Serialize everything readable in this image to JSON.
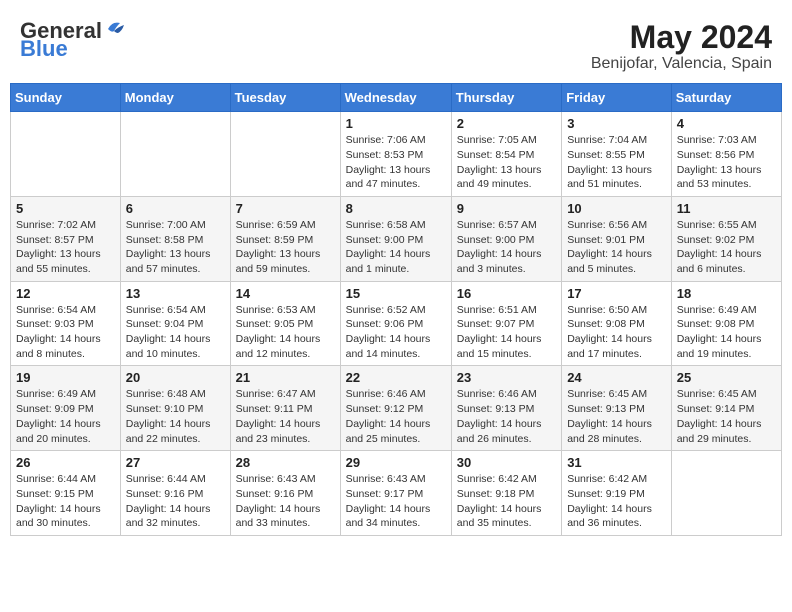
{
  "logo": {
    "general": "General",
    "blue": "Blue"
  },
  "header": {
    "month": "May 2024",
    "location": "Benijofar, Valencia, Spain"
  },
  "weekdays": [
    "Sunday",
    "Monday",
    "Tuesday",
    "Wednesday",
    "Thursday",
    "Friday",
    "Saturday"
  ],
  "weeks": [
    [
      {
        "day": "",
        "info": ""
      },
      {
        "day": "",
        "info": ""
      },
      {
        "day": "",
        "info": ""
      },
      {
        "day": "1",
        "info": "Sunrise: 7:06 AM\nSunset: 8:53 PM\nDaylight: 13 hours and 47 minutes."
      },
      {
        "day": "2",
        "info": "Sunrise: 7:05 AM\nSunset: 8:54 PM\nDaylight: 13 hours and 49 minutes."
      },
      {
        "day": "3",
        "info": "Sunrise: 7:04 AM\nSunset: 8:55 PM\nDaylight: 13 hours and 51 minutes."
      },
      {
        "day": "4",
        "info": "Sunrise: 7:03 AM\nSunset: 8:56 PM\nDaylight: 13 hours and 53 minutes."
      }
    ],
    [
      {
        "day": "5",
        "info": "Sunrise: 7:02 AM\nSunset: 8:57 PM\nDaylight: 13 hours and 55 minutes."
      },
      {
        "day": "6",
        "info": "Sunrise: 7:00 AM\nSunset: 8:58 PM\nDaylight: 13 hours and 57 minutes."
      },
      {
        "day": "7",
        "info": "Sunrise: 6:59 AM\nSunset: 8:59 PM\nDaylight: 13 hours and 59 minutes."
      },
      {
        "day": "8",
        "info": "Sunrise: 6:58 AM\nSunset: 9:00 PM\nDaylight: 14 hours and 1 minute."
      },
      {
        "day": "9",
        "info": "Sunrise: 6:57 AM\nSunset: 9:00 PM\nDaylight: 14 hours and 3 minutes."
      },
      {
        "day": "10",
        "info": "Sunrise: 6:56 AM\nSunset: 9:01 PM\nDaylight: 14 hours and 5 minutes."
      },
      {
        "day": "11",
        "info": "Sunrise: 6:55 AM\nSunset: 9:02 PM\nDaylight: 14 hours and 6 minutes."
      }
    ],
    [
      {
        "day": "12",
        "info": "Sunrise: 6:54 AM\nSunset: 9:03 PM\nDaylight: 14 hours and 8 minutes."
      },
      {
        "day": "13",
        "info": "Sunrise: 6:54 AM\nSunset: 9:04 PM\nDaylight: 14 hours and 10 minutes."
      },
      {
        "day": "14",
        "info": "Sunrise: 6:53 AM\nSunset: 9:05 PM\nDaylight: 14 hours and 12 minutes."
      },
      {
        "day": "15",
        "info": "Sunrise: 6:52 AM\nSunset: 9:06 PM\nDaylight: 14 hours and 14 minutes."
      },
      {
        "day": "16",
        "info": "Sunrise: 6:51 AM\nSunset: 9:07 PM\nDaylight: 14 hours and 15 minutes."
      },
      {
        "day": "17",
        "info": "Sunrise: 6:50 AM\nSunset: 9:08 PM\nDaylight: 14 hours and 17 minutes."
      },
      {
        "day": "18",
        "info": "Sunrise: 6:49 AM\nSunset: 9:08 PM\nDaylight: 14 hours and 19 minutes."
      }
    ],
    [
      {
        "day": "19",
        "info": "Sunrise: 6:49 AM\nSunset: 9:09 PM\nDaylight: 14 hours and 20 minutes."
      },
      {
        "day": "20",
        "info": "Sunrise: 6:48 AM\nSunset: 9:10 PM\nDaylight: 14 hours and 22 minutes."
      },
      {
        "day": "21",
        "info": "Sunrise: 6:47 AM\nSunset: 9:11 PM\nDaylight: 14 hours and 23 minutes."
      },
      {
        "day": "22",
        "info": "Sunrise: 6:46 AM\nSunset: 9:12 PM\nDaylight: 14 hours and 25 minutes."
      },
      {
        "day": "23",
        "info": "Sunrise: 6:46 AM\nSunset: 9:13 PM\nDaylight: 14 hours and 26 minutes."
      },
      {
        "day": "24",
        "info": "Sunrise: 6:45 AM\nSunset: 9:13 PM\nDaylight: 14 hours and 28 minutes."
      },
      {
        "day": "25",
        "info": "Sunrise: 6:45 AM\nSunset: 9:14 PM\nDaylight: 14 hours and 29 minutes."
      }
    ],
    [
      {
        "day": "26",
        "info": "Sunrise: 6:44 AM\nSunset: 9:15 PM\nDaylight: 14 hours and 30 minutes."
      },
      {
        "day": "27",
        "info": "Sunrise: 6:44 AM\nSunset: 9:16 PM\nDaylight: 14 hours and 32 minutes."
      },
      {
        "day": "28",
        "info": "Sunrise: 6:43 AM\nSunset: 9:16 PM\nDaylight: 14 hours and 33 minutes."
      },
      {
        "day": "29",
        "info": "Sunrise: 6:43 AM\nSunset: 9:17 PM\nDaylight: 14 hours and 34 minutes."
      },
      {
        "day": "30",
        "info": "Sunrise: 6:42 AM\nSunset: 9:18 PM\nDaylight: 14 hours and 35 minutes."
      },
      {
        "day": "31",
        "info": "Sunrise: 6:42 AM\nSunset: 9:19 PM\nDaylight: 14 hours and 36 minutes."
      },
      {
        "day": "",
        "info": ""
      }
    ]
  ]
}
